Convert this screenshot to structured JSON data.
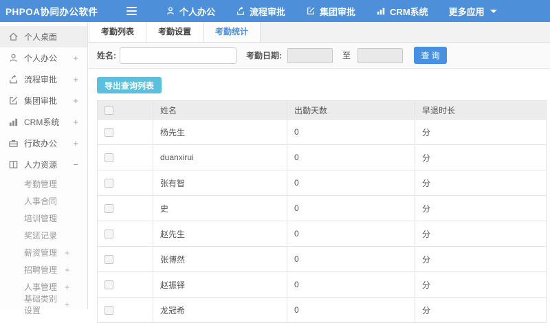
{
  "topbar": {
    "logo": "PHPOA协同办公软件",
    "nav": [
      {
        "label": "个人办公",
        "icon": "person-icon"
      },
      {
        "label": "流程审批",
        "icon": "workflow-icon"
      },
      {
        "label": "集团审批",
        "icon": "edit-icon"
      },
      {
        "label": "CRM系统",
        "icon": "chart-icon"
      },
      {
        "label": "更多应用",
        "icon": "caret-down-icon"
      }
    ]
  },
  "sidebar": {
    "items": [
      {
        "label": "个人桌面",
        "expand": "",
        "icon": "home-icon"
      },
      {
        "label": "个人办公",
        "expand": "+",
        "icon": "person-icon"
      },
      {
        "label": "流程审批",
        "expand": "+",
        "icon": "workflow-icon"
      },
      {
        "label": "集团审批",
        "expand": "+",
        "icon": "edit-icon"
      },
      {
        "label": "CRM系统",
        "expand": "+",
        "icon": "chart-icon"
      },
      {
        "label": "行政办公",
        "expand": "+",
        "icon": "briefcase-icon"
      },
      {
        "label": "人力资源",
        "expand": "−",
        "icon": "hr-icon"
      }
    ],
    "subitems": [
      {
        "label": "考勤管理",
        "expand": ""
      },
      {
        "label": "人事合同",
        "expand": ""
      },
      {
        "label": "培训管理",
        "expand": ""
      },
      {
        "label": "奖惩记录",
        "expand": ""
      },
      {
        "label": "薪资管理",
        "expand": "+"
      },
      {
        "label": "招聘管理",
        "expand": "+"
      },
      {
        "label": "人事管理",
        "expand": "+"
      },
      {
        "label": "基础类别设置",
        "expand": "+"
      }
    ]
  },
  "tabs": [
    {
      "label": "考勤列表"
    },
    {
      "label": "考勤设置"
    },
    {
      "label": "考勤统计"
    }
  ],
  "filter": {
    "name_label": "姓名:",
    "name_value": "",
    "date_label": "考勤日期:",
    "date_from": "",
    "date_to": "",
    "to_label": "至",
    "search_button": "查 询"
  },
  "toolbar": {
    "export_button": "导出查询列表"
  },
  "table": {
    "headers": {
      "name": "姓名",
      "days": "出勤天数",
      "late": "早退时长"
    },
    "rows": [
      {
        "name": "杨先生",
        "days": "0",
        "late": "分"
      },
      {
        "name": "duanxirui",
        "days": "0",
        "late": "分"
      },
      {
        "name": "张有智",
        "days": "0",
        "late": "分"
      },
      {
        "name": "史",
        "days": "0",
        "late": "分"
      },
      {
        "name": "赵先生",
        "days": "0",
        "late": "分"
      },
      {
        "name": "张博然",
        "days": "0",
        "late": "分"
      },
      {
        "name": "赵振铎",
        "days": "0",
        "late": "分"
      },
      {
        "name": "龙冠希",
        "days": "0",
        "late": "分"
      }
    ]
  },
  "colors": {
    "topbar": "#4d90d9",
    "tab_active_text": "#4a90d9",
    "search_button": "#4a90e2",
    "export_button": "#5bc0de",
    "table_header_bg": "#ececec"
  }
}
